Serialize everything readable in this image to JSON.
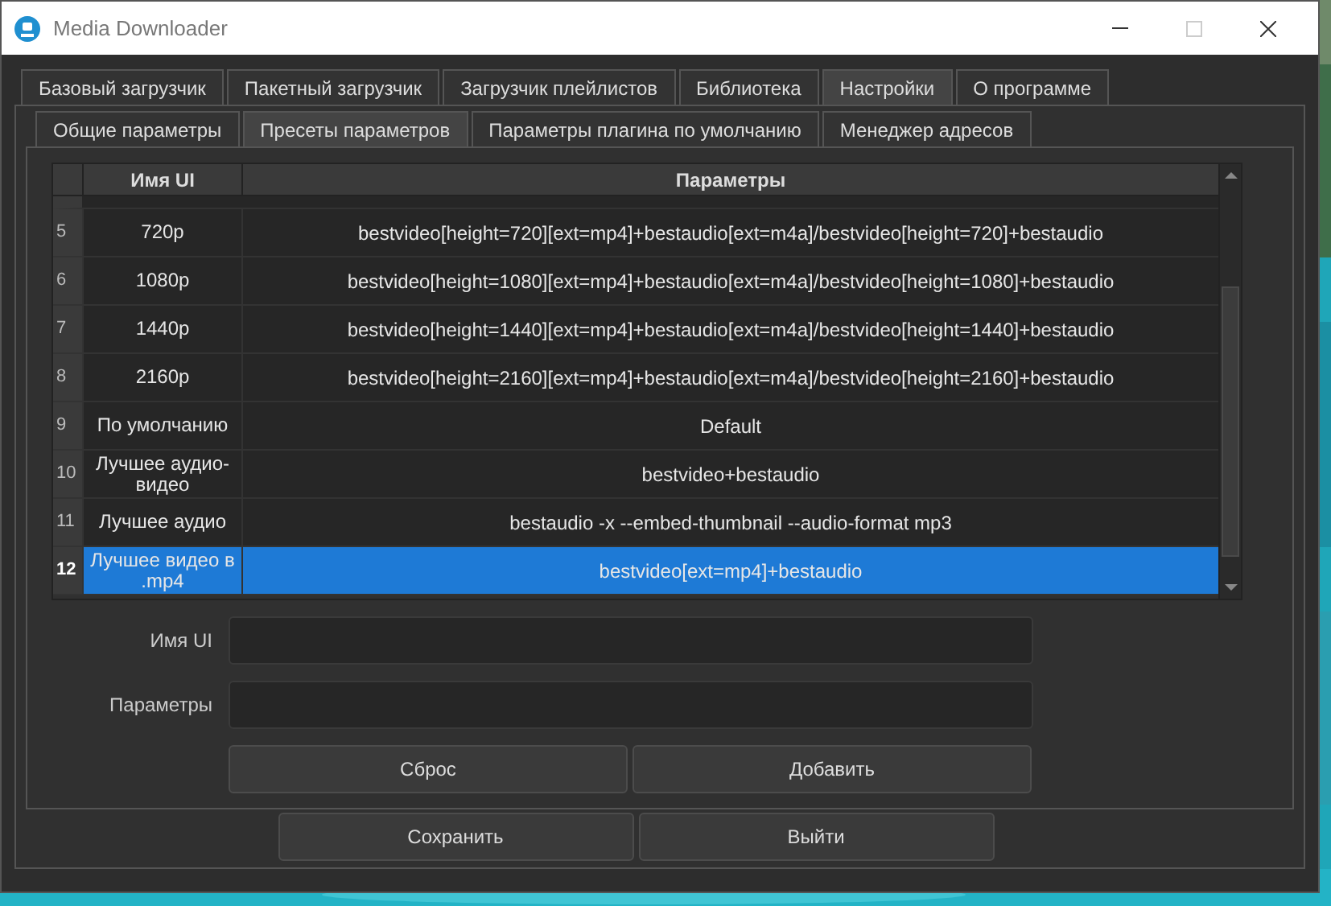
{
  "window": {
    "title": "Media Downloader"
  },
  "tabs": [
    {
      "label": "Базовый загрузчик",
      "selected": false
    },
    {
      "label": "Пакетный загрузчик",
      "selected": false
    },
    {
      "label": "Загрузчик плейлистов",
      "selected": false
    },
    {
      "label": "Библиотека",
      "selected": false
    },
    {
      "label": "Настройки",
      "selected": true
    },
    {
      "label": "О программе",
      "selected": false
    }
  ],
  "subtabs": [
    {
      "label": "Общие параметры",
      "selected": false
    },
    {
      "label": "Пресеты параметров",
      "selected": true
    },
    {
      "label": "Параметры плагина по умолчанию",
      "selected": false
    },
    {
      "label": "Менеджер адресов",
      "selected": false
    }
  ],
  "table": {
    "columns": [
      "Имя UI",
      "Параметры"
    ],
    "rows": [
      {
        "number": "5",
        "name": "720p",
        "params": "bestvideo[height=720][ext=mp4]+bestaudio[ext=m4a]/bestvideo[height=720]+bestaudio",
        "selected": false
      },
      {
        "number": "6",
        "name": "1080p",
        "params": "bestvideo[height=1080][ext=mp4]+bestaudio[ext=m4a]/bestvideo[height=1080]+bestaudio",
        "selected": false
      },
      {
        "number": "7",
        "name": "1440p",
        "params": "bestvideo[height=1440][ext=mp4]+bestaudio[ext=m4a]/bestvideo[height=1440]+bestaudio",
        "selected": false
      },
      {
        "number": "8",
        "name": "2160p",
        "params": "bestvideo[height=2160][ext=mp4]+bestaudio[ext=m4a]/bestvideo[height=2160]+bestaudio",
        "selected": false
      },
      {
        "number": "9",
        "name": "По умолчанию",
        "params": "Default",
        "selected": false
      },
      {
        "number": "10",
        "name": "Лучшее аудио-видео",
        "params": "bestvideo+bestaudio",
        "selected": false
      },
      {
        "number": "11",
        "name": "Лучшее аудио",
        "params": "bestaudio -x --embed-thumbnail --audio-format mp3",
        "selected": false
      },
      {
        "number": "12",
        "name": "Лучшее видео в .mp4",
        "params": "bestvideo[ext=mp4]+bestaudio",
        "selected": true
      }
    ]
  },
  "form": {
    "fields": [
      {
        "label": "Имя UI"
      },
      {
        "label": "Параметры"
      }
    ],
    "buttons": [
      "Сброс",
      "Добавить"
    ]
  },
  "buttons": [
    "Сохранить",
    "Выйти"
  ]
}
